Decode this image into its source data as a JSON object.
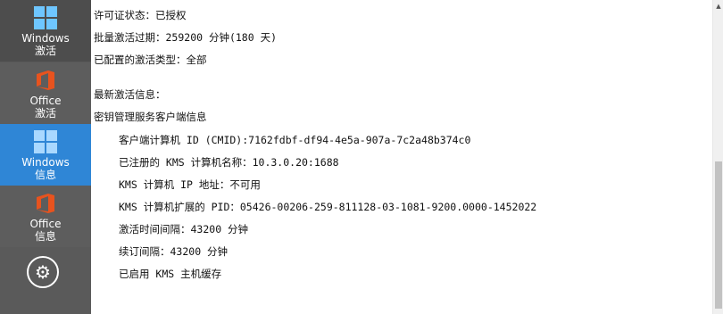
{
  "sidebar": {
    "items": [
      {
        "line1": "Windows",
        "line2": "激活"
      },
      {
        "line1": "Office",
        "line2": "激活"
      },
      {
        "line1": "Windows",
        "line2": "信息"
      },
      {
        "line1": "Office",
        "line2": "信息"
      }
    ],
    "settings_icon": "⚙"
  },
  "content": {
    "license_status": "许可证状态：已授权",
    "volume_expiry": "批量激活过期：259200 分钟(180 天)",
    "activation_type": "已配置的激活类型：全部",
    "latest_info_heading": "最新激活信息：",
    "kms_client_heading": "密钥管理服务客户端信息",
    "cmid": "客户端计算机 ID (CMID):7162fdbf-df94-4e5a-907a-7c2a48b374c0",
    "registered_kms": "已注册的 KMS 计算机名称：10.3.0.20:1688",
    "kms_ip": "KMS 计算机 IP 地址：不可用",
    "kms_pid": "KMS 计算机扩展的 PID：05426-00206-259-811128-03-1081-9200.0000-1452022",
    "activation_interval": "激活时间间隔：43200 分钟",
    "renewal_interval": "续订间隔：43200 分钟",
    "host_cache": "已启用 KMS 主机缓存"
  },
  "colors": {
    "sidebar_bg": "#5a5a5a",
    "active_item": "#2f86d6",
    "windows_logo": "#6ec6ff",
    "office_logo": "#e8531e"
  }
}
